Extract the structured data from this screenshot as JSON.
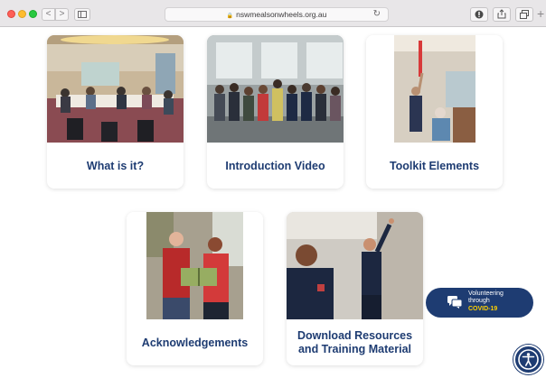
{
  "browser": {
    "url": "nswmealsonwheels.org.au",
    "lock_icon": "lock-icon",
    "back_label": "<",
    "forward_label": ">"
  },
  "cards": [
    {
      "title": "What is it?",
      "photo": "group-meeting-photo"
    },
    {
      "title": "Introduction Video",
      "photo": "team-photo"
    },
    {
      "title": "Toolkit Elements",
      "photo": "smoke-alarm-photo"
    },
    {
      "title": "Acknowledgements",
      "photo": "couple-reading-photo"
    },
    {
      "title": "Download Resources and Training Material",
      "photo": "firefighters-photo"
    }
  ],
  "volunteer_button": {
    "line1": "Volunteering",
    "line2": "through",
    "line3": "COVID-19"
  },
  "accessibility": {
    "icon": "accessibility-icon"
  },
  "colors": {
    "title_blue": "#1e3c72",
    "button_navy": "#1e3c72",
    "covid_yellow": "#ffd000"
  }
}
